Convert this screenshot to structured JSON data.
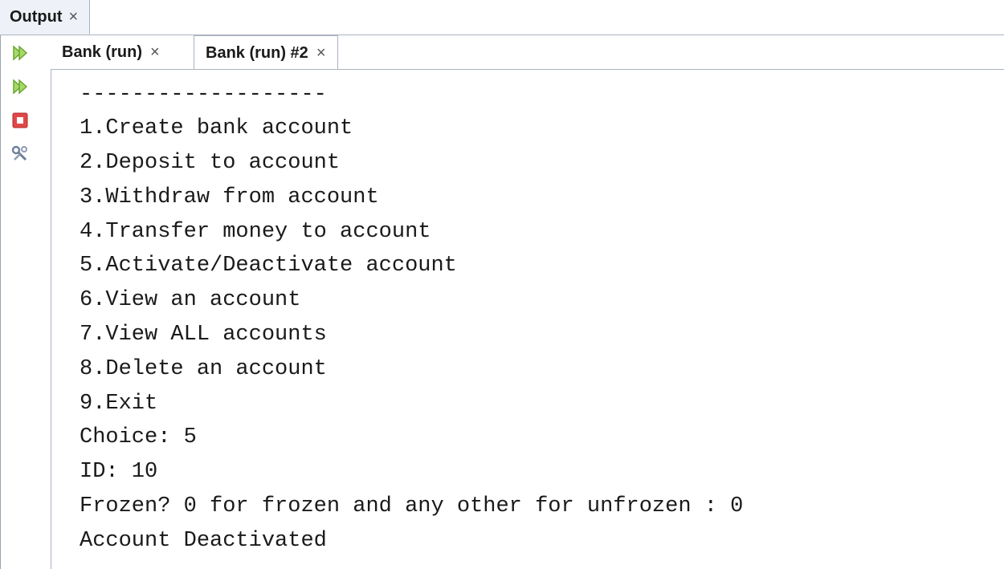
{
  "window": {
    "tab_label": "Output",
    "tab_close": "×"
  },
  "toolbar": {
    "buttons": [
      {
        "name": "rerun",
        "icon": "double-arrow-right-icon",
        "color": "#7fbf3f"
      },
      {
        "name": "rerun-with-params",
        "icon": "double-arrow-right-icon",
        "color": "#7fbf3f"
      },
      {
        "name": "stop",
        "icon": "stop-icon",
        "color": "#e04848"
      },
      {
        "name": "settings",
        "icon": "wrench-icon",
        "color": "#6b7f99"
      }
    ]
  },
  "tabs": [
    {
      "label": "Bank (run)",
      "close": "×",
      "active": false
    },
    {
      "label": "Bank (run) #2",
      "close": "×",
      "active": true
    }
  ],
  "console": {
    "lines": [
      "-------------------",
      "1.Create bank account",
      "2.Deposit to account",
      "3.Withdraw from account",
      "4.Transfer money to account",
      "5.Activate/Deactivate account",
      "6.View an account",
      "7.View ALL accounts",
      "8.Delete an account",
      "9.Exit",
      "Choice: 5",
      "ID: 10",
      "Frozen? 0 for frozen and any other for unfrozen : 0",
      "Account Deactivated"
    ]
  }
}
